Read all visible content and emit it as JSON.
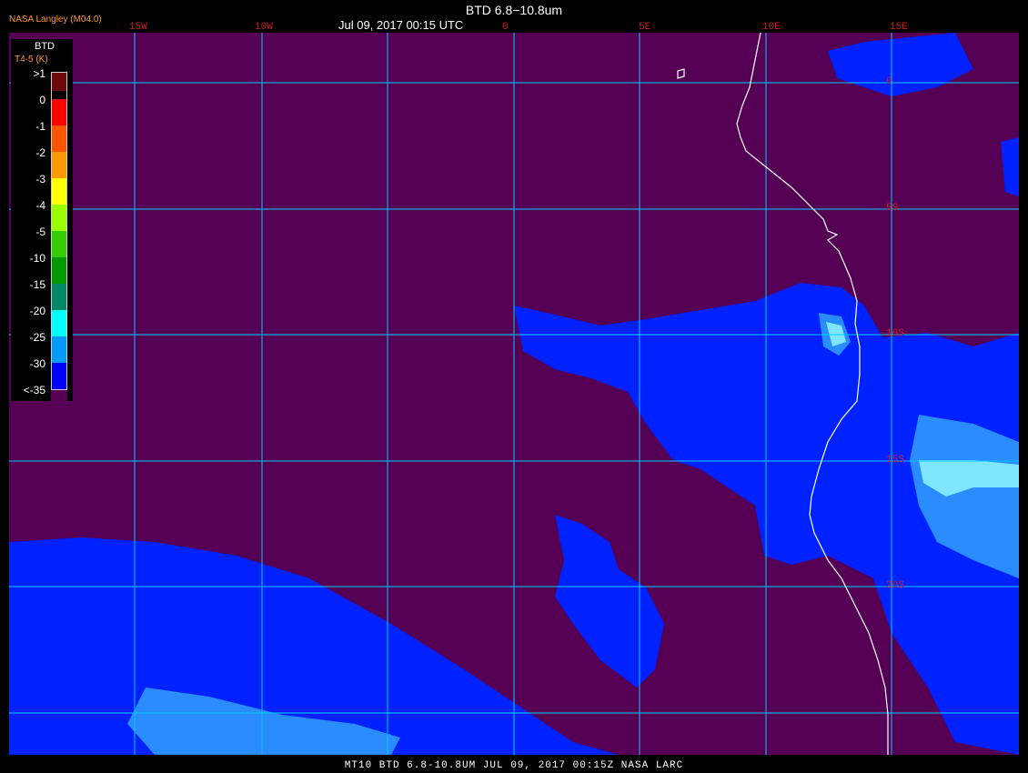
{
  "header": {
    "producer": "NASA Langley (M04.0)",
    "title": "BTD 6.8−10.8um",
    "subtitle": "Jul 09, 2017 00:15 UTC"
  },
  "footer": {
    "text": "MT10  BTD 6.8-10.8UM  JUL 09, 2017 00:15Z  NASA LARC"
  },
  "map": {
    "background_color": "#550055",
    "grid_color": "#00ccff",
    "coastline_color": "#ffffff",
    "label_color": "#cc2222",
    "longitude_labels": [
      "15W",
      "10W",
      "0",
      "5E",
      "10E",
      "15E"
    ],
    "latitude_labels": [
      "0",
      "5S",
      "10S",
      "15S",
      "20S"
    ]
  },
  "legend": {
    "title": "BTD",
    "subtitle": "T4-5 (K)",
    "entries": [
      {
        "label": ">1",
        "color": "#6a0a0a"
      },
      {
        "label": "0",
        "color": "#ff0000"
      },
      {
        "label": "-1",
        "color": "#ff5500"
      },
      {
        "label": "-2",
        "color": "#ff9900"
      },
      {
        "label": "-3",
        "color": "#ffff00"
      },
      {
        "label": "-4",
        "color": "#99ff00"
      },
      {
        "label": "-5",
        "color": "#33cc00"
      },
      {
        "label": "-10",
        "color": "#009900"
      },
      {
        "label": "-15",
        "color": "#008866"
      },
      {
        "label": "-20",
        "color": "#00ffff"
      },
      {
        "label": "-25",
        "color": "#0099ff"
      },
      {
        "label": "-30",
        "color": "#0000ff"
      },
      {
        "label": "<-35",
        "color": "#550055"
      }
    ]
  },
  "colors": {
    "low_btd": "#0022ff",
    "mid_btd": "#2a8cff",
    "high_btd": "#7fe6ff",
    "producer_text": "#ff9933"
  }
}
